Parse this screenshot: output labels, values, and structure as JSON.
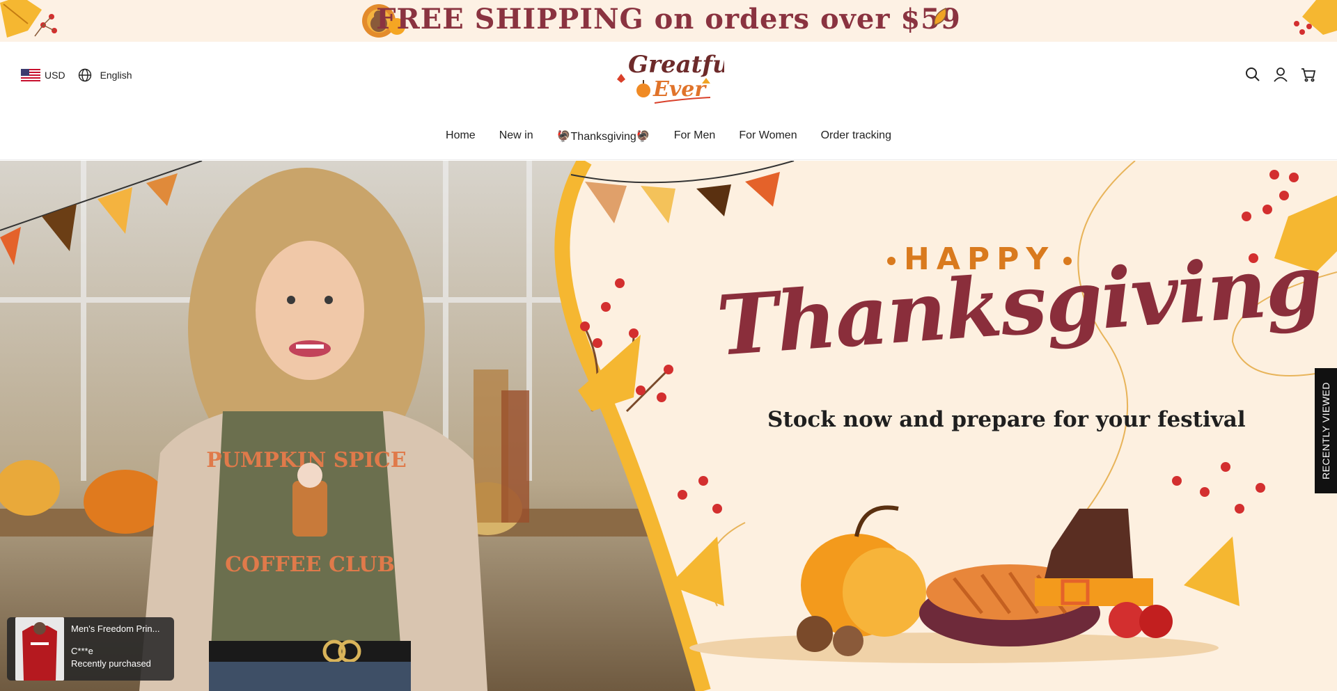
{
  "announcement": {
    "text": "FREE SHIPPING on orders over $59"
  },
  "header": {
    "currency": "USD",
    "language": "English",
    "logo_text": [
      "Greatful",
      "Ever"
    ],
    "icons": [
      "search-icon",
      "account-icon",
      "cart-icon"
    ]
  },
  "nav": {
    "items": [
      "Home",
      "New in",
      "🦃Thanksgiving🦃",
      "For Men",
      "For Women",
      "Order tracking"
    ]
  },
  "hero": {
    "happy": "HAPPY",
    "title": "Thanksgiving",
    "subtitle": "Stock now and prepare for your festival",
    "shirt_text": [
      "PUMPKIN SPICE",
      "COFFEE CLUB"
    ]
  },
  "recently_viewed": {
    "label": "RECENTLY VIEWED"
  },
  "purchase_popup": {
    "product": "Men's Freedom Prin...",
    "customer": "C***e",
    "status": "Recently purchased"
  },
  "colors": {
    "brand": "#8a2e3b",
    "accent": "#d97a1e",
    "cream": "#fdf0e0"
  }
}
